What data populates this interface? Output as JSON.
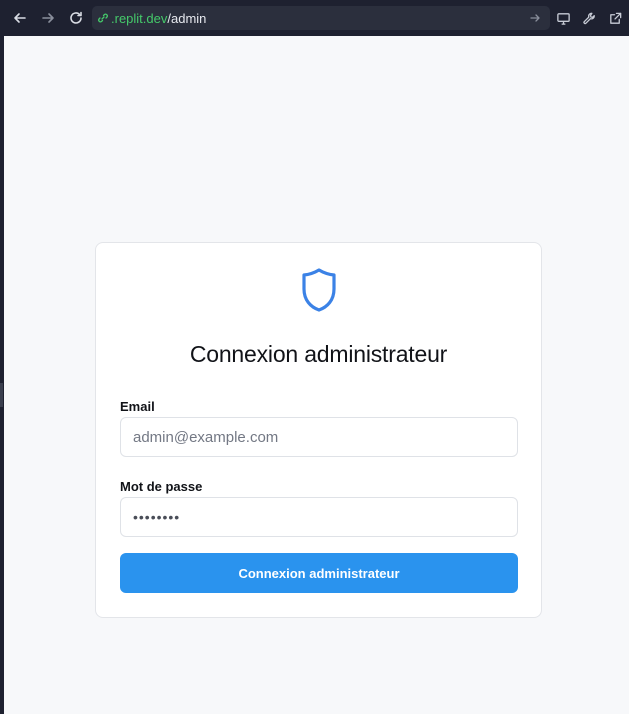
{
  "browser": {
    "url_host": ".replit.dev",
    "url_path": "/admin",
    "icons": [
      "back-icon",
      "forward-icon",
      "reload-icon",
      "link-icon",
      "go-icon",
      "monitor-icon",
      "wrench-icon",
      "external-link-icon"
    ]
  },
  "login": {
    "title": "Connexion administrateur",
    "email_label": "Email",
    "email_placeholder": "admin@example.com",
    "password_label": "Mot de passe",
    "password_value": "••••••••",
    "submit_label": "Connexion administrateur"
  },
  "colors": {
    "accent": "#2a93ee",
    "shield": "#3b82e6",
    "url_host": "#45c96a",
    "chrome": "#1e2130",
    "page_bg": "#f7f8fa"
  }
}
